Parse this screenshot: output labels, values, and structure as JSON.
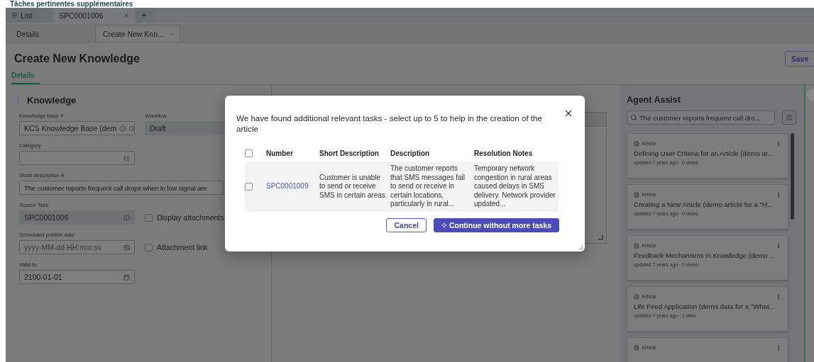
{
  "page_heading": "Tâches pertinentes supplémentaires",
  "app_tabs": [
    {
      "kind": "list",
      "label": "List",
      "selected": false
    },
    {
      "kind": "record",
      "label": "SPC0001006",
      "selected": true
    }
  ],
  "sub_tabs": [
    {
      "label": "Details",
      "selected": false,
      "closable": false
    },
    {
      "label": "Create New Kno...",
      "selected": true,
      "closable": true
    }
  ],
  "form": {
    "title": "Create New Knowledge",
    "save_button": "Save",
    "tabs": [
      {
        "label": "Details",
        "selected": true
      }
    ],
    "section_title": "Knowledge",
    "rows": [
      [
        {
          "kind": "lookup",
          "label": "Knowledge base",
          "required": true,
          "value": "KCS Knowledge Base (dem"
        },
        {
          "kind": "readonly",
          "label": "Workflow",
          "required": false,
          "value": "Draft"
        }
      ],
      [
        {
          "kind": "tree",
          "label": "Category",
          "required": false
        }
      ],
      [
        {
          "kind": "wide",
          "label": "Short description",
          "required": true,
          "value": "The customer reports frequent call drops when in low signal are"
        }
      ],
      [
        {
          "kind": "readonly-info",
          "label": "Source Task",
          "required": false,
          "value": "SPC0001006"
        },
        {
          "kind": "checkbox",
          "label": "Display attachments",
          "checked": false
        }
      ],
      [
        {
          "kind": "datetime",
          "label": "Scheduled publish date",
          "required": false,
          "placeholder": "yyyy-MM-dd HH:mm:ss"
        },
        {
          "kind": "checkbox",
          "label": "Attachment link",
          "checked": false
        }
      ],
      [
        {
          "kind": "date",
          "label": "Valid to",
          "required": false,
          "value": "2100-01-01"
        }
      ]
    ]
  },
  "agent_assist": {
    "title": "Agent Assist",
    "search_value": "The customer reports frequent call dro...",
    "cards": [
      {
        "type": "Article",
        "title": "Defining User Criteria for an Article (demo ar...",
        "meta": "updated 7 years ago · 0 views"
      },
      {
        "type": "Article",
        "title": "Creating a New Article (demo article for a \"H...",
        "meta": "updated 7 years ago · 0 views"
      },
      {
        "type": "Article",
        "title": "Feedback Mechanisms in Knowledge (demo ...",
        "meta": "updated 7 years ago · 0 views"
      },
      {
        "type": "Article",
        "title": "Life Feed Application (demo data for a \"What...",
        "meta": "updated 7 years ago · 1 view"
      },
      {
        "type": "Article"
      }
    ]
  },
  "dialog": {
    "message": "We have found additional relevant tasks - select up to 5 to help in the creation of the article",
    "select_all_checked": false,
    "columns": [
      "Number",
      "Short Description",
      "Description",
      "Resolution Notes"
    ],
    "rows": [
      {
        "checked": false,
        "number": "SPC0001009",
        "short_description": "Customer is unable to send or receive SMS in certain areas.",
        "description": "The customer reports that SMS messages fail to send or receive in certain locations, particularly in rural...",
        "resolution_notes": "Temporary network congestion in rural areas caused delays in SMS delivery. Network provider updated..."
      }
    ],
    "buttons": [
      {
        "kind": "secondary",
        "label": "Cancel"
      },
      {
        "kind": "primary",
        "label": "Continue without more tasks"
      }
    ]
  }
}
